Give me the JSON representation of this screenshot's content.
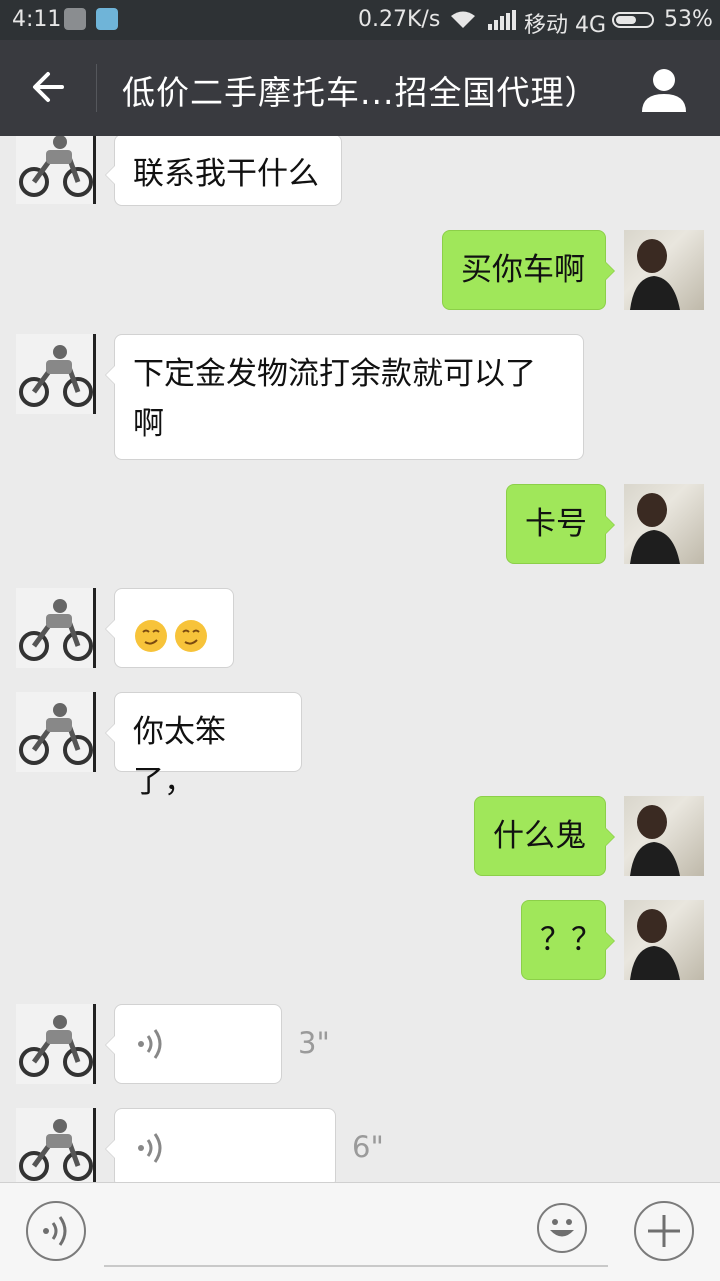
{
  "status_bar": {
    "time": "4:11",
    "speed": "0.27K/s",
    "carrier": "移动 4G",
    "battery": "53%"
  },
  "header": {
    "title": "低价二手摩托车...招全国代理）"
  },
  "messages": [
    {
      "side": "in",
      "text": "联系我干什么"
    },
    {
      "side": "out",
      "text": "买你车啊"
    },
    {
      "side": "in",
      "text": "下定金发物流打余款就可以了啊"
    },
    {
      "side": "out",
      "text": "卡号"
    },
    {
      "side": "in",
      "emoji": [
        "smirk-emoji",
        "smirk-emoji"
      ]
    },
    {
      "side": "in",
      "text": "你太笨了，"
    },
    {
      "side": "out",
      "text": "什么鬼"
    },
    {
      "side": "out",
      "text": "？？"
    },
    {
      "side": "in",
      "voice": true,
      "duration": "3\""
    },
    {
      "side": "in",
      "voice": true,
      "duration": "6\""
    }
  ],
  "colors": {
    "status_bar_bg": "#2e3235",
    "title_bar_bg": "#393a3f",
    "chat_bg": "#ebebeb",
    "outgoing_bubble": "#a0e75a",
    "incoming_bubble": "#ffffff"
  },
  "input_bar": {
    "voice_button_icon": "voice-icon",
    "emoji_button_icon": "smiley-icon",
    "more_button_icon": "plus-icon"
  }
}
